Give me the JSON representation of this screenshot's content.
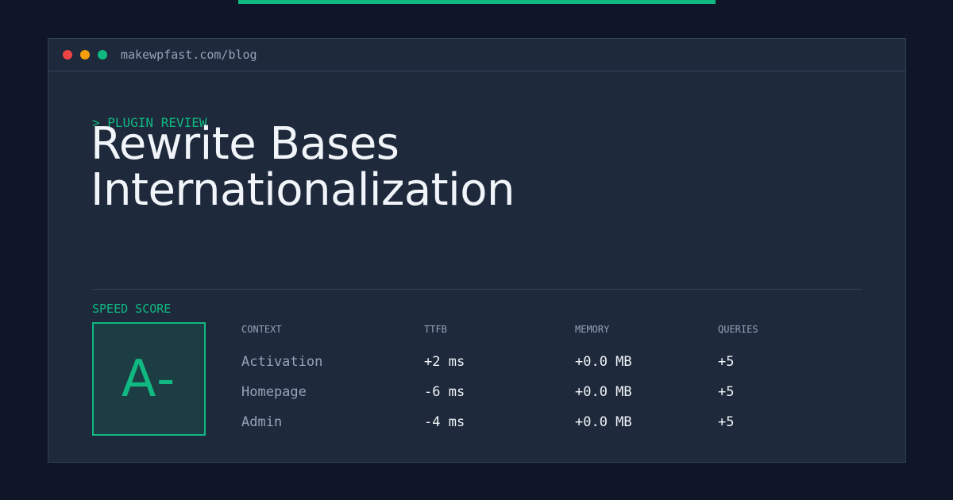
{
  "window": {
    "url": "makewpfast.com/blog"
  },
  "header": {
    "kicker": "> PLUGIN REVIEW",
    "title_line1": "Rewrite Bases",
    "title_line2": "Internationalization"
  },
  "score": {
    "label": "SPEED SCORE",
    "grade": "A-"
  },
  "table": {
    "headers": [
      "CONTEXT",
      "TTFB",
      "MEMORY",
      "QUERIES"
    ],
    "rows": [
      [
        "Activation",
        "+2 ms",
        "+0.0 MB",
        "+5"
      ],
      [
        "Homepage",
        "-6 ms",
        "+0.0 MB",
        "+5"
      ],
      [
        "Admin",
        "-4 ms",
        "+0.0 MB",
        "+5"
      ]
    ]
  },
  "colors": {
    "background": "#0e1628",
    "panel": "#1e293b",
    "accent": "#10b981",
    "dot_red": "#ef4444",
    "dot_amber": "#f59e0b",
    "dot_green": "#10b981"
  }
}
